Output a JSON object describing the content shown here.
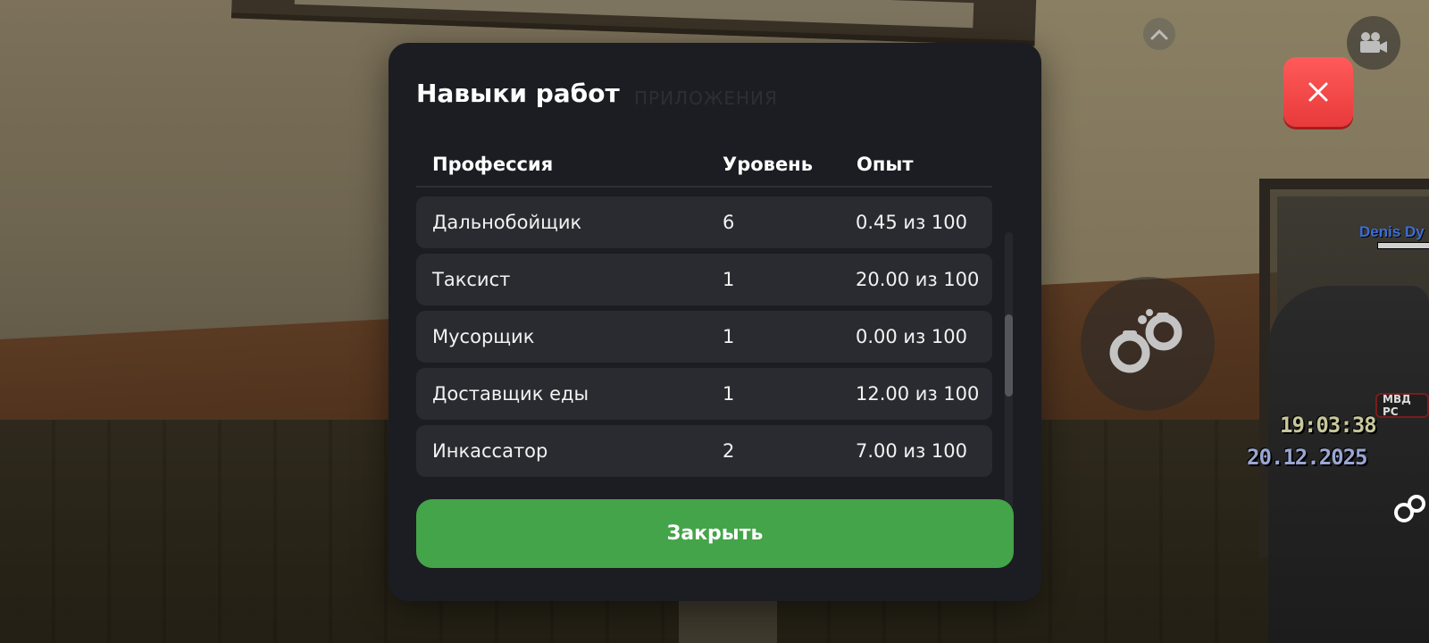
{
  "modal": {
    "title": "Навыки работ",
    "ghost_title": "ПРИЛОЖЕНИЯ",
    "columns": {
      "profession": "Профессия",
      "level": "Уровень",
      "experience": "Опыт"
    },
    "rows": [
      {
        "profession": "Дальнобойщик",
        "level": "6",
        "experience": "0.45 из 100"
      },
      {
        "profession": "Таксист",
        "level": "1",
        "experience": "20.00 из 100"
      },
      {
        "profession": "Мусорщик",
        "level": "1",
        "experience": "0.00 из 100"
      },
      {
        "profession": "Доставщик еды",
        "level": "1",
        "experience": "12.00 из 100"
      },
      {
        "profession": "Инкассатор",
        "level": "2",
        "experience": "7.00 из 100"
      }
    ],
    "close_label": "Закрыть"
  },
  "hud": {
    "time": "19:03:38",
    "date": "20.12.2025",
    "player_name": "Denis Dy",
    "badge_text": "МВД РС"
  },
  "colors": {
    "modal_bg": "#1c1d22",
    "row_bg": "#2a2b31",
    "close_button": "#44a449",
    "hud_close": "#f04444"
  },
  "icons": {
    "scroll_up": "chevron-up-icon",
    "camera": "video-camera-icon",
    "close": "close-icon",
    "handcuffs": "handcuffs-icon"
  }
}
